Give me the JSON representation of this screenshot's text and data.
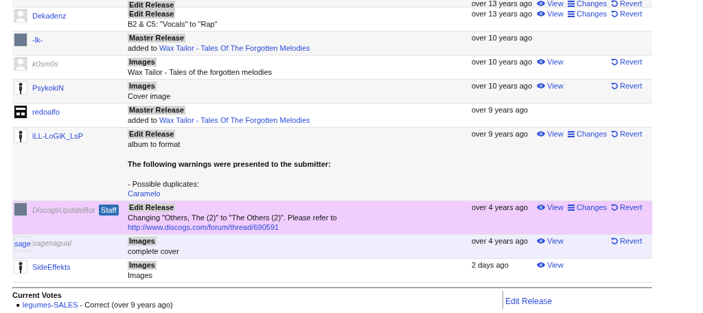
{
  "history": {
    "rows": [
      {
        "color": "#f6f6f6",
        "type": "Edit Release",
        "time": "over 13 years ago",
        "actions": [
          {
            "kind": "view",
            "label": "View"
          },
          {
            "kind": "changes",
            "label": "Changes"
          },
          {
            "kind": "revert",
            "label": "Revert"
          }
        ]
      },
      {
        "color": "#ffffff",
        "user": {
          "name": "Dekadenz",
          "inactive": false,
          "avatar": {
            "kind": "default"
          }
        },
        "type": "Edit Release",
        "description": [
          {
            "kind": "text",
            "text": "B2 & C5: \"Vocals\" to \"Rap\""
          }
        ],
        "time": "over 13 years ago",
        "actions": [
          {
            "kind": "view",
            "label": "View"
          },
          {
            "kind": "changes",
            "label": "Changes"
          },
          {
            "kind": "revert",
            "label": "Revert"
          }
        ]
      },
      {
        "color": "#f6f6f6",
        "user": {
          "name": "-lk-",
          "inactive": false,
          "avatar": {
            "kind": "photo"
          }
        },
        "type": "Master Release",
        "description": [
          {
            "kind": "text",
            "text": "added to ",
            "link": "Wax Tailor - Tales Of The Forgotten Melodies"
          }
        ],
        "time": "over 10 years ago",
        "actions": []
      },
      {
        "color": "#ffffff",
        "user": {
          "name": "k0sm0s",
          "inactive": true,
          "avatar": {
            "kind": "default"
          }
        },
        "type": "Images",
        "description": [
          {
            "kind": "text",
            "text": "Wax Tailor - Tales of the forgotten melodies"
          }
        ],
        "time": "over 10 years ago",
        "actions": [
          {
            "kind": "view",
            "label": "View"
          },
          {
            "kind": "revert",
            "label": "Revert"
          }
        ]
      },
      {
        "color": "#f6f6f6",
        "user": {
          "name": "PsykokiN",
          "inactive": false,
          "avatar": {
            "kind": "figure"
          }
        },
        "type": "Images",
        "description": [
          {
            "kind": "text",
            "text": "Cover image"
          }
        ],
        "time": "over 10 years ago",
        "actions": [
          {
            "kind": "view",
            "label": "View"
          },
          {
            "kind": "revert",
            "label": "Revert"
          }
        ]
      },
      {
        "color": "#ffffff",
        "user": {
          "name": "redoalfo",
          "inactive": false,
          "avatar": {
            "kind": "logo"
          }
        },
        "type": "Master Release",
        "description": [
          {
            "kind": "text",
            "text": "added to ",
            "link": "Wax Tailor - Tales Of The Forgotten Melodies"
          }
        ],
        "time": "over 9 years ago",
        "actions": []
      },
      {
        "color": "#f6f6f6",
        "user": {
          "name": "iLL-LoGiK_LsP",
          "inactive": false,
          "avatar": {
            "kind": "figure"
          }
        },
        "type": "Edit Release",
        "description": [
          {
            "kind": "text",
            "text": "album to format"
          },
          {
            "kind": "warning",
            "text": "The following warnings were presented to the submitter:"
          },
          {
            "kind": "text",
            "text": "- Possible duplicates:"
          },
          {
            "kind": "link",
            "link": "Caramelo"
          }
        ],
        "time": "over 9 years ago",
        "actions": [
          {
            "kind": "view",
            "label": "View"
          },
          {
            "kind": "changes",
            "label": "Changes"
          },
          {
            "kind": "revert",
            "label": "Revert"
          }
        ]
      },
      {
        "color": "#f0cdfd",
        "user": {
          "name": "DiscogsUpdateBot",
          "inactive": true,
          "badge": "Staff",
          "avatar": {
            "kind": "photo"
          }
        },
        "type": "Edit Release",
        "description": [
          {
            "kind": "text",
            "text": "Changing \"Others, The (2)\" to \"The Others (2)\". Please refer to ",
            "link": "http://www.discogs.com/forum/thread/690591"
          }
        ],
        "time": "over 4 years ago",
        "actions": [
          {
            "kind": "view",
            "label": "View"
          },
          {
            "kind": "changes",
            "label": "Changes"
          },
          {
            "kind": "revert",
            "label": "Revert"
          }
        ]
      },
      {
        "color": "#eeeefc",
        "user": {
          "name": "sagenagual",
          "inactive": true,
          "avatar": {
            "kind": "text",
            "text": "sage"
          }
        },
        "type": "Images",
        "description": [
          {
            "kind": "text",
            "text": "complete cover"
          }
        ],
        "time": "over 4 years ago",
        "actions": [
          {
            "kind": "view",
            "label": "View"
          },
          {
            "kind": "revert",
            "label": "Revert"
          }
        ]
      },
      {
        "color": "#ffffff",
        "user": {
          "name": "SideEffekts",
          "inactive": false,
          "avatar": {
            "kind": "figure"
          }
        },
        "type": "Images",
        "description": [
          {
            "kind": "text",
            "text": "Images"
          }
        ],
        "time": "2 days ago",
        "actions": [
          {
            "kind": "view",
            "label": "View"
          }
        ]
      }
    ]
  },
  "votes": {
    "title": "Current Votes",
    "items": [
      {
        "marker": "■",
        "user": "legumes-SALES",
        "text": " - Correct (over 9 years ago)"
      }
    ]
  },
  "sidebar": {
    "links": [
      "Edit Release"
    ]
  }
}
